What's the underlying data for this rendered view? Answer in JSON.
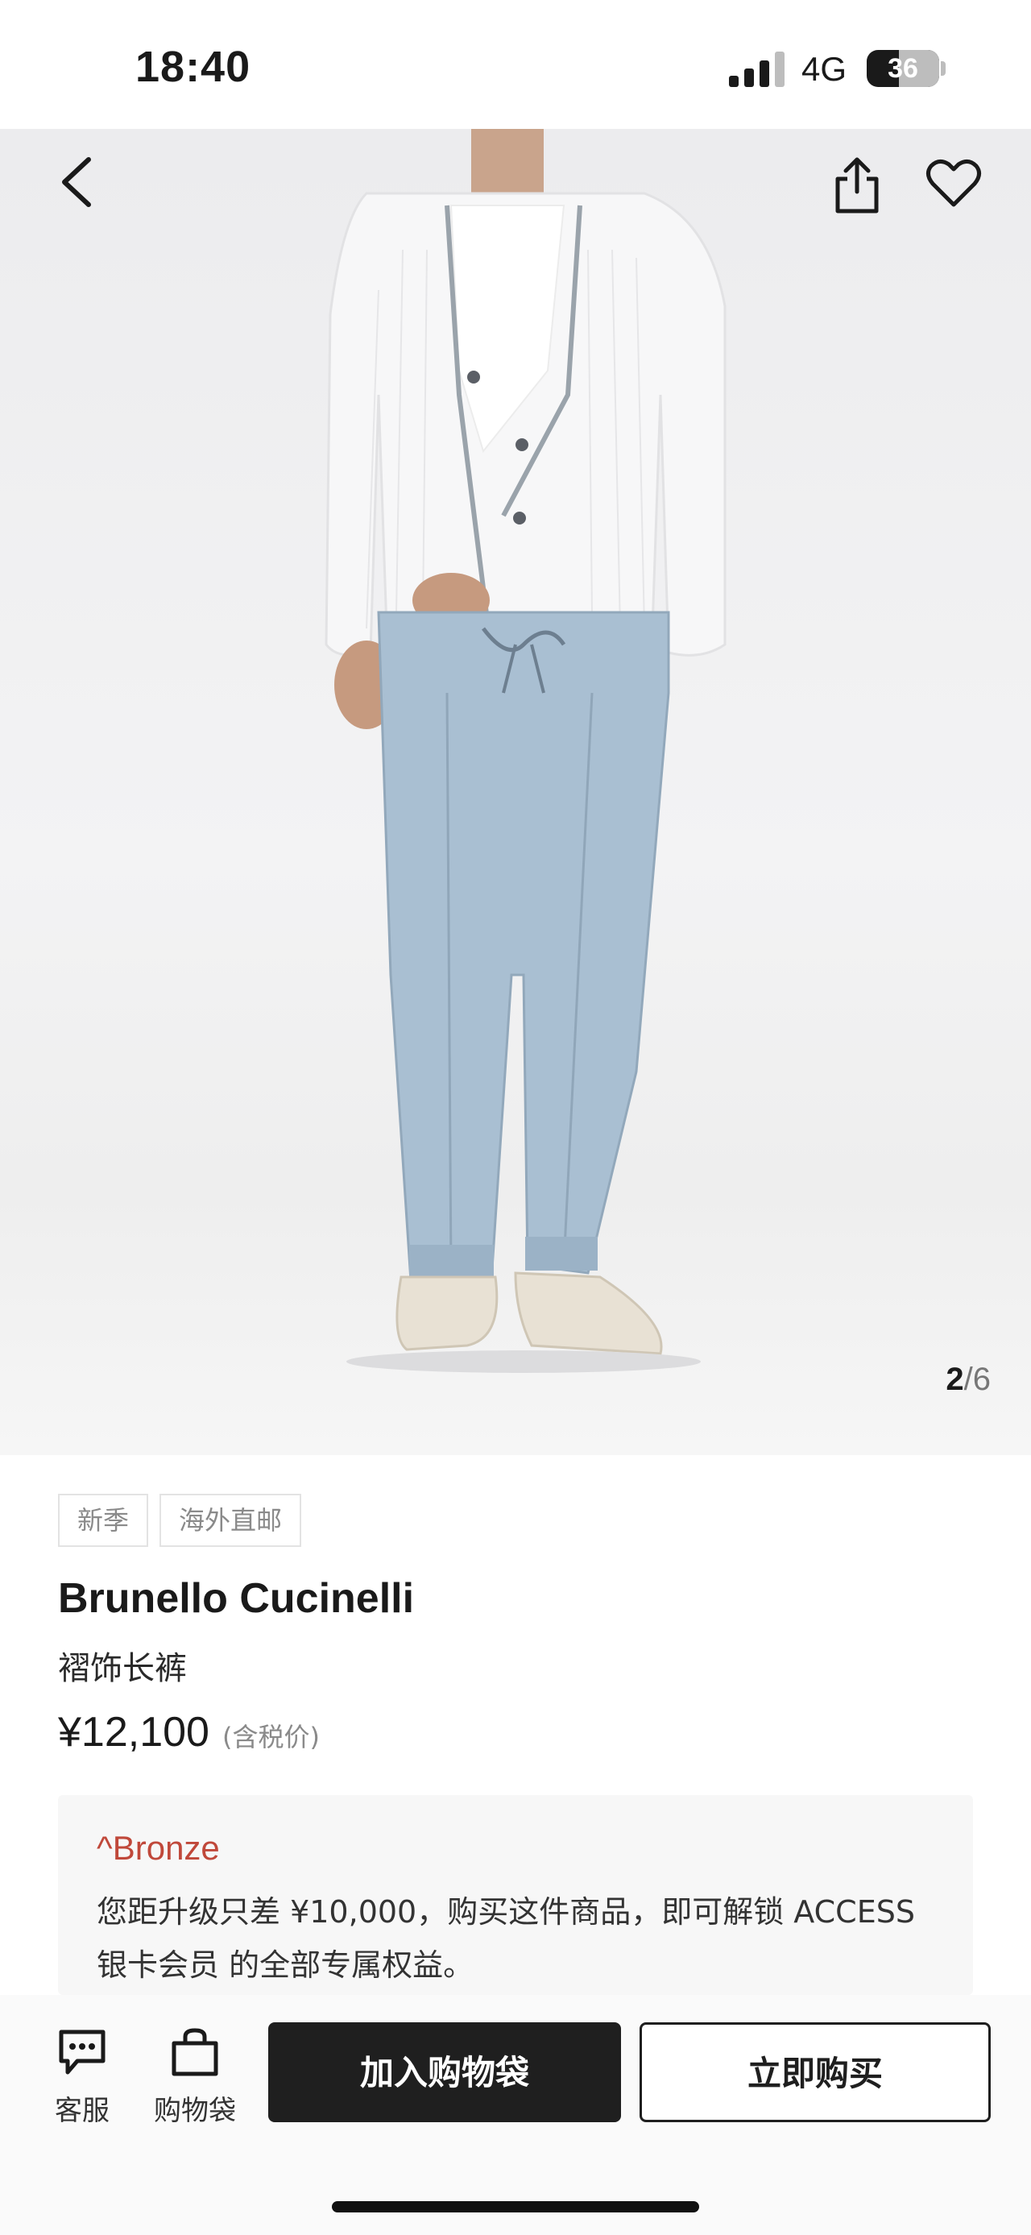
{
  "status_bar": {
    "time": "18:40",
    "network": "4G",
    "battery": "36"
  },
  "gallery": {
    "current": "2",
    "separator": "/",
    "total": "6"
  },
  "product": {
    "tags": [
      "新季",
      "海外直邮"
    ],
    "brand": "Brunello Cucinelli",
    "name": "褶饰长裤",
    "price": "¥12,100",
    "price_note": "(含税价)"
  },
  "membership": {
    "level": "^Bronze",
    "message": "您距升级只差 ¥10,000，购买这件商品，即可解锁 ACCESS 银卡会员 的全部专属权益。"
  },
  "bottom_bar": {
    "service_label": "客服",
    "bag_label": "购物袋",
    "add_to_bag": "加入购物袋",
    "buy_now": "立即购买"
  }
}
